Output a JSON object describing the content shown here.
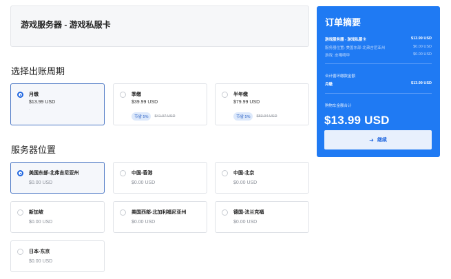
{
  "product": {
    "title": "游戏服务器 - 游戏私服卡"
  },
  "billing": {
    "section_title": "选择出账周期",
    "options": [
      {
        "name": "月缴",
        "price": "$13.99 USD",
        "sub": ".",
        "selected": true
      },
      {
        "name": "季缴",
        "price": "$39.99 USD",
        "save": "节省 5%",
        "old_price": "$41.97 USD",
        "selected": false
      },
      {
        "name": "半年缴",
        "price": "$79.99 USD",
        "save": "节省 5%",
        "old_price": "$83.94 USD",
        "selected": false
      }
    ]
  },
  "location": {
    "section_title": "服务器位置",
    "options": [
      {
        "name": "美国东部-北弗吉尼亚州",
        "price": "$0.00 USD",
        "selected": true
      },
      {
        "name": "中国-香港",
        "price": "$0.00 USD",
        "selected": false
      },
      {
        "name": "中国-北京",
        "price": "$0.00 USD",
        "selected": false
      },
      {
        "name": "新加坡",
        "price": "$0.00 USD",
        "selected": false
      },
      {
        "name": "美国西部-北加利福尼亚州",
        "price": "$0.00 USD",
        "selected": false
      },
      {
        "name": "德国-法兰克福",
        "price": "$0.00 USD",
        "selected": false
      },
      {
        "name": "日本-东京",
        "price": "$0.00 USD",
        "selected": false
      }
    ]
  },
  "summary": {
    "title": "订单摘要",
    "lines": [
      {
        "label": "游戏服务器 - 游戏私服卡",
        "value": "$13.99 USD"
      },
      {
        "label": "服务器位置: 美国东部-北弗吉尼亚州",
        "value": "$0.00 USD"
      },
      {
        "label": "游戏: 皮嘎嘀甲",
        "value": "$0.00 USD"
      }
    ],
    "recurring_label": "合计循环缴款金额",
    "recurring": {
      "label": "月缴",
      "value": "$13.99 USD"
    },
    "total_label": "购物车金额合计",
    "total": "$13.99 USD",
    "continue_label": "继续"
  },
  "colors": {
    "accent": "#1f7af3",
    "selected_border": "#4a76c4",
    "radio": "#1f66e0"
  }
}
